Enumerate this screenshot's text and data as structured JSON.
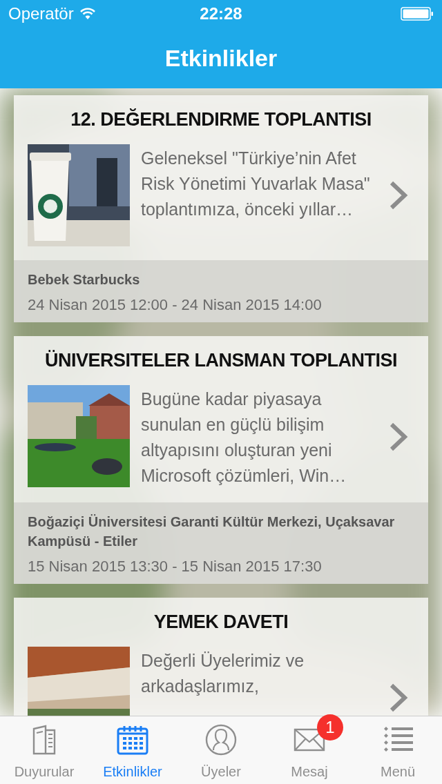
{
  "status_bar": {
    "carrier": "Operatör",
    "time": "22:28"
  },
  "nav_bar": {
    "title": "Etkinlikler"
  },
  "events": [
    {
      "title": "12. DEĞERLENDIRME TOPLANTISI",
      "description": "Geleneksel \"Türkiye’nin Afet Risk Yönetimi Yuvarlak Masa\" toplantımıza, önceki yıllar…",
      "location": "Bebek Starbucks",
      "date": "24 Nisan 2015 12:00 - 24 Nisan 2015 14:00"
    },
    {
      "title": "ÜNIVERSITELER LANSMAN TOPLANTISI",
      "description": "Bugüne kadar piyasaya sunulan en güçlü bilişim altyapısını oluşturan yeni Microsoft çözümleri, Win…",
      "location": "Boğaziçi Üniversitesi Garanti Kültür Merkezi, Uçaksavar Kampüsü - Etiler",
      "date": "15 Nisan 2015 13:30 - 15 Nisan 2015 17:30"
    },
    {
      "title": "YEMEK DAVETI",
      "description": "Değerli Üyelerimiz ve arkadaşlarımız,"
    }
  ],
  "tab_bar": [
    {
      "label": "Duyurular",
      "selected": false
    },
    {
      "label": "Etkinlikler",
      "selected": true
    },
    {
      "label": "Üyeler",
      "selected": false
    },
    {
      "label": "Mesaj",
      "selected": false,
      "badge": "1"
    },
    {
      "label": "Menü",
      "selected": false
    }
  ]
}
